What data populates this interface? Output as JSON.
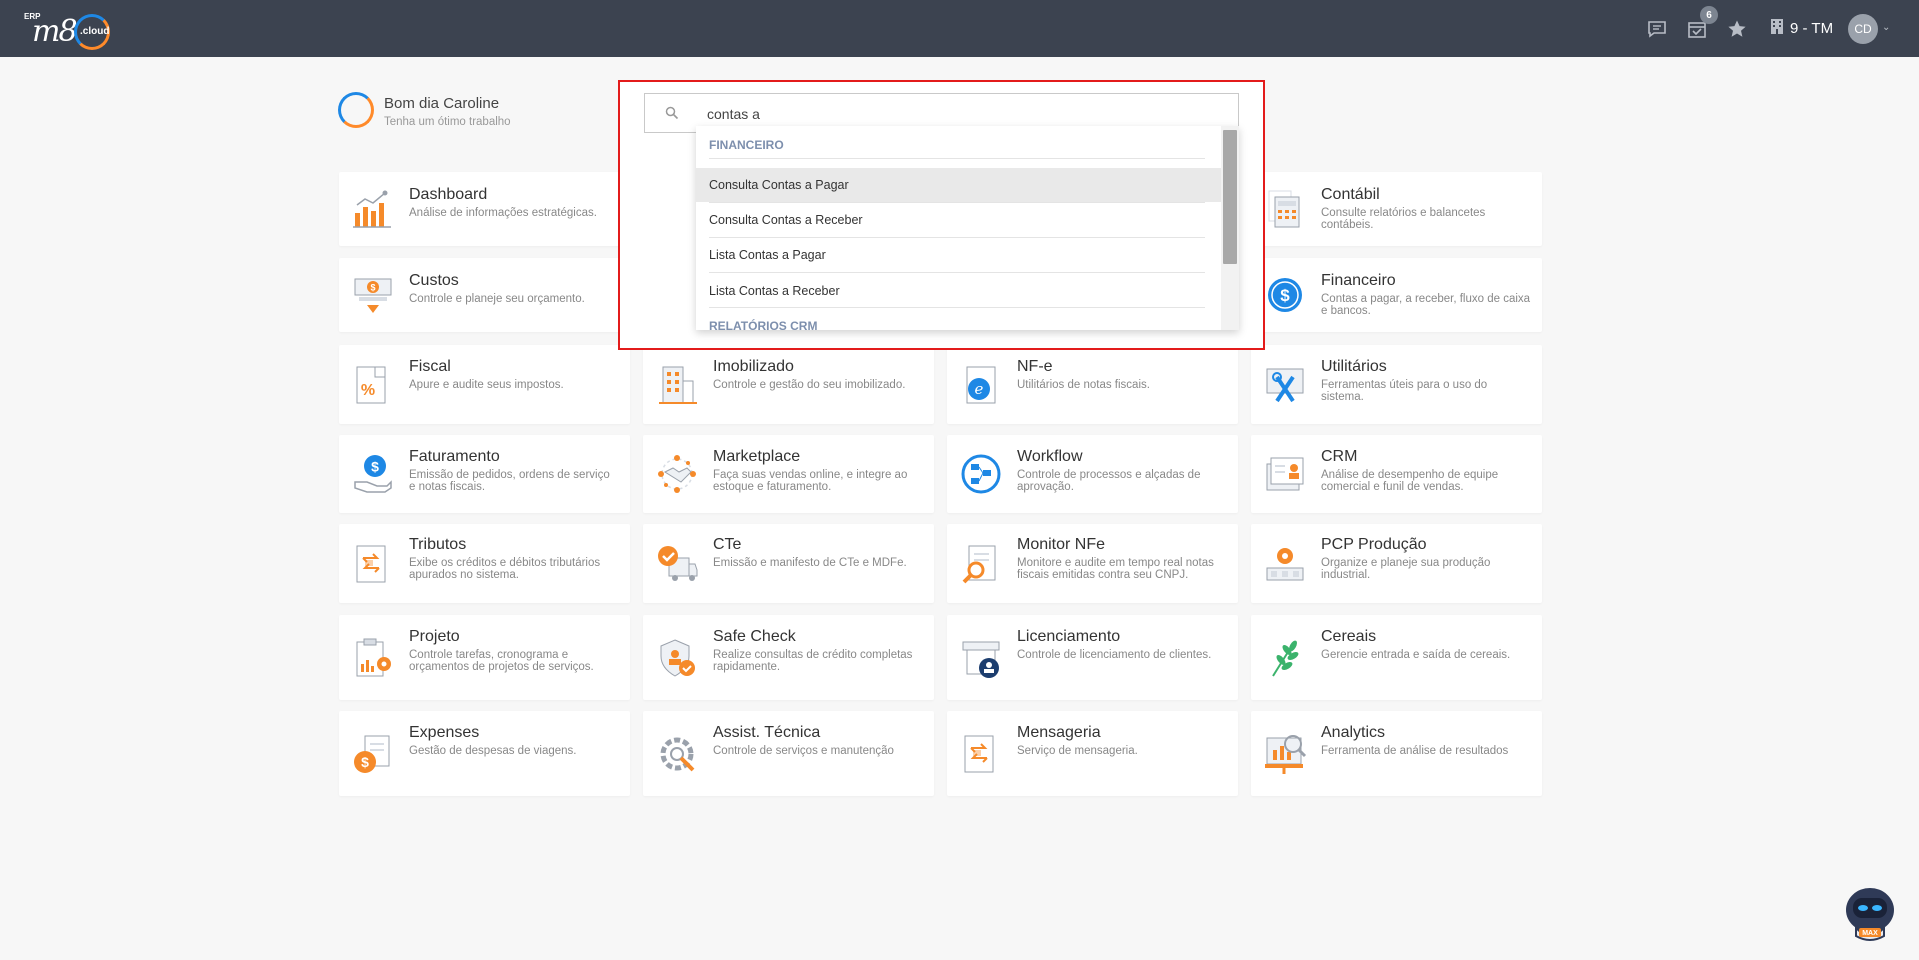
{
  "topbar": {
    "logo_erp": "ERP",
    "logo_m8": "m8",
    "logo_cloud": ".cloud",
    "calendar_badge": "6",
    "company": "9 - TM",
    "avatar": "CD"
  },
  "greeting": {
    "title": "Bom dia Caroline",
    "subtitle": "Tenha um ótimo trabalho"
  },
  "search": {
    "value": "contas a",
    "groups": [
      {
        "label": "FINANCEIRO",
        "items": [
          "Consulta Contas a Pagar",
          "Consulta Contas a Receber",
          "Lista Contas a Pagar",
          "Lista Contas a Receber"
        ]
      },
      {
        "label": "RELATÓRIOS CRM",
        "items": []
      }
    ]
  },
  "modules": [
    {
      "title": "Dashboard",
      "desc": "Análise de informações estratégicas.",
      "icon": "chart-icon"
    },
    {
      "title": "",
      "desc": "",
      "icon": "contact-card-icon"
    },
    {
      "title": "",
      "desc": "",
      "icon": ""
    },
    {
      "title": "Contábil",
      "desc": "Consulte relatórios e balancetes contábeis.",
      "icon": "calculator-icon"
    },
    {
      "title": "Custos",
      "desc": "Controle e planeje seu orçamento.",
      "icon": "cash-register-icon"
    },
    {
      "title": "",
      "desc": "",
      "icon": "certificate-icon"
    },
    {
      "title": "",
      "desc": "",
      "icon": ""
    },
    {
      "title": "Financeiro",
      "desc": "Contas a pagar, a receber, fluxo de caixa e bancos.",
      "icon": "dollar-coin-icon"
    },
    {
      "title": "Fiscal",
      "desc": "Apure e audite seus impostos.",
      "icon": "percent-document-icon"
    },
    {
      "title": "Imobilizado",
      "desc": "Controle e gestão do seu imobilizado.",
      "icon": "building-icon"
    },
    {
      "title": "NF-e",
      "desc": "Utilitários de notas fiscais.",
      "icon": "e-document-icon"
    },
    {
      "title": "Utilitários",
      "desc": "Ferramentas úteis para o uso do sistema.",
      "icon": "tools-icon"
    },
    {
      "title": "Faturamento",
      "desc": "Emissão de pedidos, ordens de serviço e notas fiscais.",
      "icon": "hand-coin-icon"
    },
    {
      "title": "Marketplace",
      "desc": "Faça suas vendas online, e integre ao estoque e faturamento.",
      "icon": "handshake-icon"
    },
    {
      "title": "Workflow",
      "desc": "Controle de processos e alçadas de aprovação.",
      "icon": "workflow-icon"
    },
    {
      "title": "CRM",
      "desc": "Análise de desempenho de equipe comercial e funil de vendas.",
      "icon": "crm-card-icon"
    },
    {
      "title": "Tributos",
      "desc": "Exibe os créditos e débitos tributários apurados no sistema.",
      "icon": "exchange-document-icon"
    },
    {
      "title": "CTe",
      "desc": "Emissão e manifesto de CTe e MDFe.",
      "icon": "truck-check-icon"
    },
    {
      "title": "Monitor NFe",
      "desc": "Monitore e audite em tempo real notas fiscais emitidas contra seu CNPJ.",
      "icon": "magnifier-document-icon"
    },
    {
      "title": "PCP Produção",
      "desc": "Organize e planeje sua produção industrial.",
      "icon": "production-gear-icon"
    },
    {
      "title": "Projeto",
      "desc": "Controle tarefas, cronograma e orçamentos de projetos de serviços.",
      "icon": "clipboard-gear-icon"
    },
    {
      "title": "Safe Check",
      "desc": "Realize consultas de crédito completas rapidamente.",
      "icon": "shield-check-icon"
    },
    {
      "title": "Licenciamento",
      "desc": "Controle de licenciamento de clientes.",
      "icon": "license-badge-icon"
    },
    {
      "title": "Cereais",
      "desc": "Gerencie entrada e saída de cereais.",
      "icon": "grain-icon"
    },
    {
      "title": "Expenses",
      "desc": "Gestão de despesas de viagens.",
      "icon": "expense-coin-icon"
    },
    {
      "title": "Assist. Técnica",
      "desc": "Controle de serviços e manutenção",
      "icon": "gear-wrench-icon"
    },
    {
      "title": "Mensageria",
      "desc": "Serviço de mensageria.",
      "icon": "exchange-document-icon"
    },
    {
      "title": "Analytics",
      "desc": "Ferramenta de análise de resultados",
      "icon": "analytics-board-icon"
    }
  ],
  "robot_label": "MAX",
  "colors": {
    "topbar": "#3c4350",
    "accent_orange": "#f58a2a",
    "accent_blue": "#1e88e5",
    "highlight_border": "#e31b1b"
  }
}
